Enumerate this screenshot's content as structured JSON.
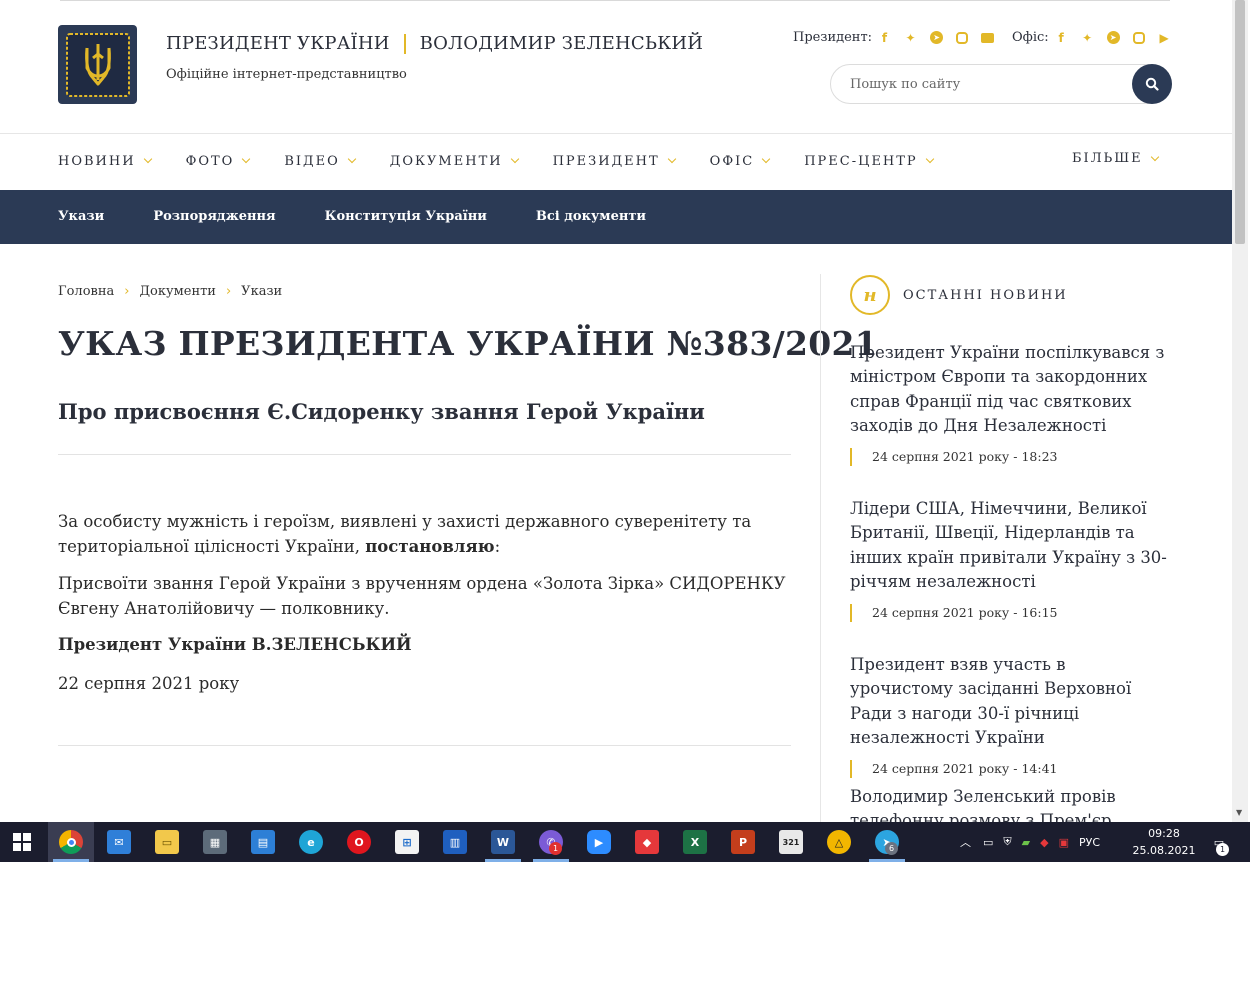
{
  "header": {
    "title_left": "ПРЕЗИДЕНТ УКРАЇНИ",
    "title_right": "ВОЛОДИМИР ЗЕЛЕНСЬКИЙ",
    "subtitle": "Офіційне інтернет-представництво",
    "president_label": "Президент:",
    "office_label": "Офіс:",
    "search_placeholder": "Пошук по сайту",
    "accent_color": "#e2b828",
    "navy_color": "#2b3a55"
  },
  "main_nav": {
    "items": [
      "НОВИНИ",
      "ФОТО",
      "ВІДЕО",
      "ДОКУМЕНТИ",
      "ПРЕЗИДЕНТ",
      "ОФІС",
      "ПРЕС-ЦЕНТР"
    ],
    "more": "БІЛЬШЕ"
  },
  "sub_nav": {
    "items": [
      "Укази",
      "Розпорядження",
      "Конституція України",
      "Всі документи"
    ]
  },
  "breadcrumb": [
    "Головна",
    "Документи",
    "Укази"
  ],
  "document": {
    "title": "УКАЗ ПРЕЗИДЕНТА УКРАЇНИ №383/2021",
    "subtitle": "Про присвоєння Є.Сидоренку звання Герой України",
    "para1_text": "За особисту мужність і героїзм, виявлені у захисті державного суверенітету та територіальної цілісності України, ",
    "para1_bold": "постановляю",
    "para1_end": ":",
    "para2": "Присвоїти звання Герой України з врученням ордена «Золота Зірка» СИДОРЕНКУ Євгену Анатолійовичу — полковнику.",
    "signature": "Президент України В.ЗЕЛЕНСЬКИЙ",
    "date": "22 серпня 2021 року"
  },
  "sidebar": {
    "badge_letter": "н",
    "heading": "ОСТАННІ НОВИНИ",
    "news": [
      {
        "title": "Президент України поспілкувався з міністром Європи та закордонних справ Франції під час святкових заходів до Дня Незалежності",
        "date": "24 серпня 2021 року - 18:23"
      },
      {
        "title": "Лідери США, Німеччини, Великої Британії, Швеції, Нідерландів та інших країн привітали Україну з 30-річчям незалежності",
        "date": "24 серпня 2021 року - 16:15"
      },
      {
        "title": "Президент взяв участь в урочистому засіданні Верховної Ради з нагоди 30-ї річниці незалежності України",
        "date": "24 серпня 2021 року - 14:41"
      },
      {
        "title": "Володимир Зеленський провів телефонну розмову з Прем'єр",
        "date": ""
      }
    ]
  },
  "taskbar": {
    "language": "РУС",
    "time": "09:28",
    "date": "25.08.2021",
    "viber_badge": "1",
    "telegram_badge": "6",
    "notifications_badge": "1",
    "icons": [
      "windows-start-icon",
      "chrome-icon",
      "mail-icon",
      "file-explorer-icon",
      "calculator-icon",
      "calendar-icon",
      "edge-icon",
      "opera-icon",
      "store-icon",
      "media-player-icon",
      "word-icon",
      "viber-icon",
      "zoom-icon",
      "anydesk-icon",
      "excel-icon",
      "powerpoint-icon",
      "video-editor-icon",
      "alert-icon",
      "telegram-icon"
    ]
  }
}
